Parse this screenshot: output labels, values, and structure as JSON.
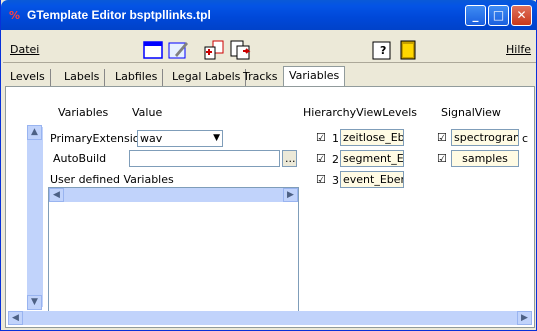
{
  "window": {
    "title": "GTemplate Editor bsptpllinks.tpl"
  },
  "menu": {
    "file": "Datei",
    "help": "Hilfe"
  },
  "tabs": [
    {
      "label": "Levels"
    },
    {
      "label": "Labels"
    },
    {
      "label": "Labfiles"
    },
    {
      "label": "Legal Labels"
    },
    {
      "label": "Tracks"
    },
    {
      "label": "Variables"
    }
  ],
  "variables": {
    "col_variables": "Variables",
    "col_value": "Value",
    "primary_extension_label": "PrimaryExtension",
    "primary_extension_value": "wav",
    "autobuild_label": "AutoBuild",
    "autobuild_value": "",
    "browse_button": "...",
    "user_defined_label": "User defined Variables"
  },
  "hierarchy": {
    "header": "HierarchyViewLevels",
    "items": [
      {
        "num": "1",
        "value": "zeitlose_Ebe"
      },
      {
        "num": "2",
        "value": "segment_Eb"
      },
      {
        "num": "3",
        "value": "event_Ebene"
      }
    ]
  },
  "signal": {
    "header": "SignalView",
    "items": [
      {
        "value": "spectrogram",
        "extra": "c"
      },
      {
        "value": "samples"
      }
    ]
  },
  "icons": [
    "window-icon",
    "save-icon",
    "edit-icon",
    "export-icon",
    "help-icon",
    "exit-icon"
  ]
}
